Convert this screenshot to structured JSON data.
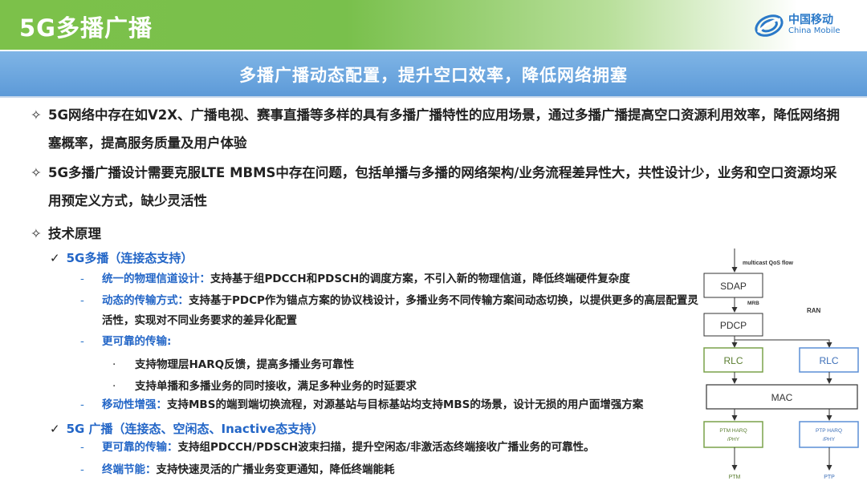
{
  "header": {
    "title": "5G多播广播",
    "logo_cn": "中国移动",
    "logo_en": "China Mobile"
  },
  "banner": {
    "text": "多播广播动态配置，提升空口效率，降低网络拥塞"
  },
  "bullets": [
    {
      "mark": "✧",
      "text": "5G网络中存在如V2X、广播电视、赛事直播等多样的具有多播广播特性的应用场景，通过多播广播提高空口资源利用效率，降低网络拥塞概率，提高服务质量及用户体验"
    },
    {
      "mark": "✧",
      "text": "5G多播广播设计需要克服LTE MBMS中存在问题，包括单播与多播的网络架构/业务流程差异性大，共性设计少，业务和空口资源均采用预定义方式，缺少灵活性"
    },
    {
      "mark": "✧",
      "text": "技术原理"
    }
  ],
  "multicast": {
    "check": "✓",
    "heading": "5G多播（连接态支持）",
    "items": [
      {
        "dash": "-",
        "label": "统一的物理信道设计：",
        "text": "支持基于组PDCCH和PDSCH的调度方案，不引入新的物理信道，降低终端硬件复杂度"
      },
      {
        "dash": "-",
        "label": "动态的传输方式：",
        "text": "支持基于PDCP作为锚点方案的协议栈设计，多播业务不同传输方案间动态切换，以提供更多的高层配置灵活性，实现对不同业务要求的差异化配置"
      },
      {
        "dash": "-",
        "label": "更可靠的传输:",
        "text": ""
      }
    ],
    "dots": [
      {
        "mark": "·",
        "text": "支持物理层HARQ反馈，提高多播业务可靠性"
      },
      {
        "mark": "·",
        "text": "支持单播和多播业务的同时接收，满足多种业务的时延要求"
      }
    ],
    "mobility": {
      "dash": "-",
      "label": "移动性增强：",
      "text": "支持MBS的端到端切换流程，对源基站与目标基站均支持MBS的场景，设计无损的用户面增强方案"
    }
  },
  "broadcast": {
    "check": "✓",
    "heading": "5G 广播（连接态、空闲态、Inactive态支持）",
    "items": [
      {
        "dash": "-",
        "label": "更可靠的传输：",
        "text": "支持组PDCCH/PDSCH波束扫描，提升空闲态/非激活态终端接收广播业务的可靠性。"
      },
      {
        "dash": "-",
        "label": "终端节能：",
        "text": "支持快速灵活的广播业务变更通知，降低终端能耗"
      }
    ]
  },
  "diagram": {
    "qos_flow": "multicast QoS flow",
    "sdap": "SDAP",
    "mrb": "MRB",
    "ran": "RAN",
    "pdcp": "PDCP",
    "rlc_left": "RLC",
    "rlc_right": "RLC",
    "mac": "MAC",
    "ptm_box_line1": "PTM HARQ",
    "ptm_box_line2": "/PHY",
    "ptp_box_line1": "PTP HARQ",
    "ptp_box_line2": "/PHY",
    "ptm": "PTM",
    "ptp": "PTP",
    "colors": {
      "green": "#7aa24a",
      "blue": "#5b8fd6",
      "dark": "#333333"
    }
  }
}
